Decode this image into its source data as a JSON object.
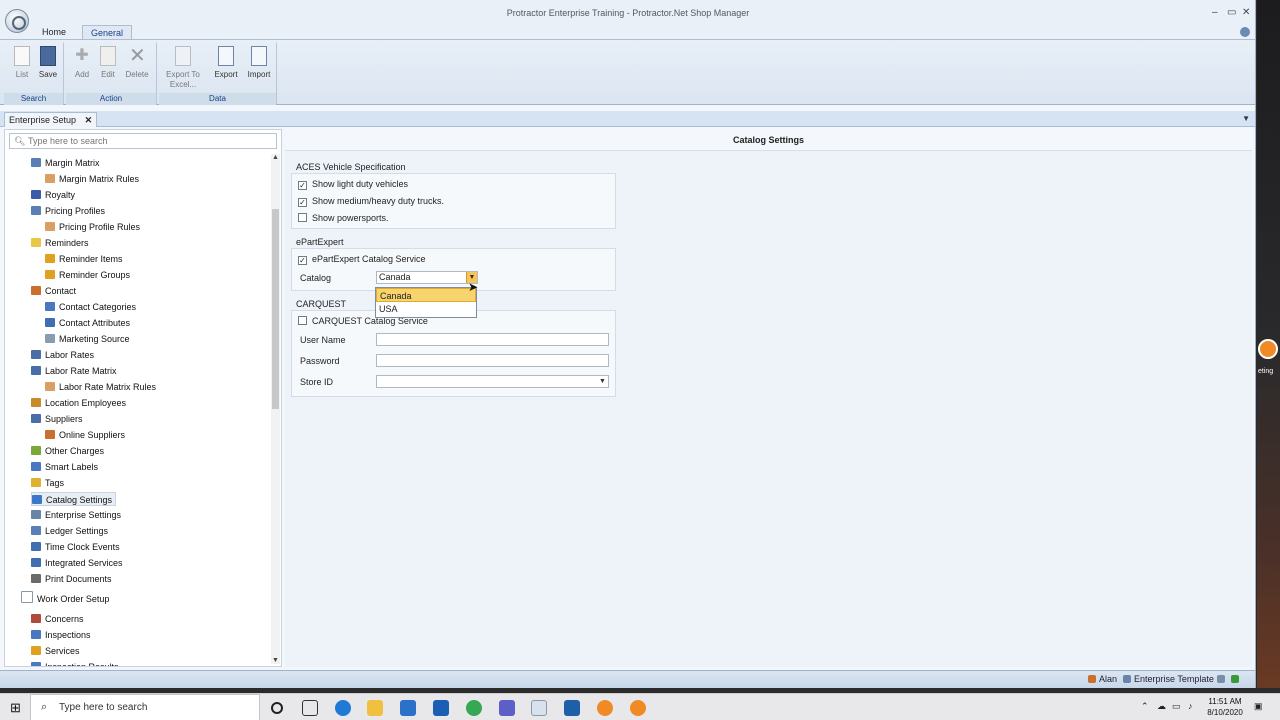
{
  "window": {
    "title": "Protractor Enterprise Training - Protractor.Net Shop Manager",
    "minimize_glyph": "–",
    "maximize_glyph": "▭",
    "close_glyph": "✕"
  },
  "ribbon": {
    "tabs": [
      {
        "label": "Home"
      },
      {
        "label": "General"
      }
    ],
    "groups": {
      "search": {
        "label": "Search",
        "buttons": [
          {
            "label": "List"
          },
          {
            "label": "Save"
          }
        ]
      },
      "action": {
        "label": "Action",
        "buttons": [
          {
            "label": "Add"
          },
          {
            "label": "Edit"
          },
          {
            "label": "Delete"
          }
        ]
      },
      "data": {
        "label": "Data",
        "buttons": [
          {
            "label": "Export To Excel..."
          },
          {
            "label": "Export"
          },
          {
            "label": "Import"
          }
        ]
      }
    }
  },
  "doc_tab": {
    "label": "Enterprise Setup",
    "close_glyph": "✕"
  },
  "nav": {
    "search_placeholder": "Type here to search",
    "items": [
      {
        "label": "Margin Matrix",
        "icon": "grid-icon",
        "color": "#5a7fb5"
      },
      {
        "label": "Margin Matrix Rules",
        "icon": "table-icon",
        "color": "#d9a066"
      },
      {
        "label": "Royalty",
        "icon": "royalty-icon",
        "color": "#3b5ba8"
      },
      {
        "label": "Pricing Profiles",
        "icon": "grid-icon",
        "color": "#5a7fb5"
      },
      {
        "label": "Pricing Profile Rules",
        "icon": "table-icon",
        "color": "#d9a066"
      },
      {
        "label": "Reminders",
        "icon": "folder-icon",
        "color": "#e8c64a"
      },
      {
        "label": "Reminder Items",
        "icon": "flag-icon",
        "color": "#e0a020"
      },
      {
        "label": "Reminder Groups",
        "icon": "flag-icon",
        "color": "#e0a020"
      },
      {
        "label": "Contact",
        "icon": "person-icon",
        "color": "#c9702f"
      },
      {
        "label": "Contact Categories",
        "icon": "category-icon",
        "color": "#4a78c0"
      },
      {
        "label": "Contact Attributes",
        "icon": "attribute-icon",
        "color": "#3f6fb0"
      },
      {
        "label": "Marketing Source",
        "icon": "marketing-icon",
        "color": "#8a9bb0"
      },
      {
        "label": "Labor Rates",
        "icon": "person-icon",
        "color": "#4a6da8"
      },
      {
        "label": "Labor Rate Matrix",
        "icon": "person-icon",
        "color": "#4a6da8"
      },
      {
        "label": "Labor Rate Matrix Rules",
        "icon": "table-icon",
        "color": "#d9a066"
      },
      {
        "label": "Location Employees",
        "icon": "location-icon",
        "color": "#c98a2a"
      },
      {
        "label": "Suppliers",
        "icon": "person-icon",
        "color": "#4a6da8"
      },
      {
        "label": "Online Suppliers",
        "icon": "person-icon",
        "color": "#c9702f"
      },
      {
        "label": "Other Charges",
        "icon": "charge-icon",
        "color": "#7aa83a"
      },
      {
        "label": "Smart Labels",
        "icon": "label-icon",
        "color": "#4a78c0"
      },
      {
        "label": "Tags",
        "icon": "tag-icon",
        "color": "#e0b030"
      },
      {
        "label": "Catalog Settings",
        "icon": "catalog-icon",
        "color": "#3a78c8"
      },
      {
        "label": "Enterprise Settings",
        "icon": "settings-icon",
        "color": "#6a84a8"
      },
      {
        "label": "Ledger Settings",
        "icon": "ledger-icon",
        "color": "#5a7fb5"
      },
      {
        "label": "Time Clock Events",
        "icon": "clock-icon",
        "color": "#3f6fb0"
      },
      {
        "label": "Integrated Services",
        "icon": "services-icon",
        "color": "#3f6fb0"
      },
      {
        "label": "Print Documents",
        "icon": "printer-icon",
        "color": "#6a6a6a"
      },
      {
        "label": "Work Order Setup",
        "icon": "document-icon",
        "color": "#8899aa"
      },
      {
        "label": "Concerns",
        "icon": "book-icon",
        "color": "#b04a3a"
      },
      {
        "label": "Inspections",
        "icon": "inspection-icon",
        "color": "#4a78c0"
      },
      {
        "label": "Services",
        "icon": "services-icon",
        "color": "#e0a020"
      },
      {
        "label": "Inspection Results",
        "icon": "results-icon",
        "color": "#4a78c0"
      }
    ]
  },
  "content": {
    "title": "Catalog Settings",
    "aces": {
      "title": "ACES Vehicle Specification",
      "options": [
        {
          "label": "Show light duty vehicles",
          "checked": true
        },
        {
          "label": "Show medium/heavy duty trucks.",
          "checked": true
        },
        {
          "label": "Show powersports.",
          "checked": false
        }
      ]
    },
    "epartexpert": {
      "title": "ePartExpert",
      "service_label": "ePartExpert Catalog Service",
      "service_checked": true,
      "catalog_label": "Catalog",
      "catalog_value": "Canada",
      "catalog_options": [
        "Canada",
        "USA"
      ]
    },
    "carquest": {
      "title": "CARQUEST",
      "service_label": "CARQUEST Catalog Service",
      "service_checked": false,
      "username_label": "User Name",
      "username_value": "",
      "password_label": "Password",
      "password_value": "",
      "storeid_label": "Store ID",
      "storeid_value": ""
    }
  },
  "status": {
    "user": "Alan",
    "template": "Enterprise Template"
  },
  "desktop": {
    "edge_text": "eting"
  },
  "taskbar": {
    "search_placeholder": "Type here to search",
    "time": "11:51 AM",
    "date": "8/10/2020"
  },
  "colors": {
    "accent": "#15428b",
    "highlight": "#f8d46e",
    "brand_orange": "#f08a24"
  }
}
